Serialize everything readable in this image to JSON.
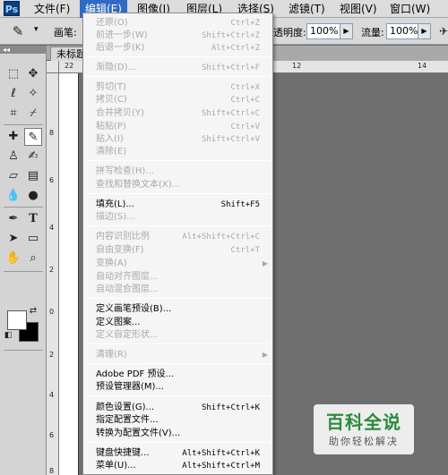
{
  "app": {
    "logo": "Ps"
  },
  "menubar": {
    "items": [
      {
        "label": "文件(F)"
      },
      {
        "label": "编辑(E)"
      },
      {
        "label": "图像(I)"
      },
      {
        "label": "图层(L)"
      },
      {
        "label": "选择(S)"
      },
      {
        "label": "滤镜(T)"
      },
      {
        "label": "视图(V)"
      },
      {
        "label": "窗口(W)"
      }
    ]
  },
  "options_bar": {
    "brush_label": "画笔:",
    "opacity_label": "透明度:",
    "opacity_value": "100%",
    "flow_label": "流量:",
    "flow_value": "100%"
  },
  "document": {
    "tab_title": "未标题",
    "ruler_h": [
      "22",
      "12",
      "14"
    ],
    "ruler_v": [
      "8",
      "6",
      "4",
      "2",
      "0",
      "2",
      "4",
      "6",
      "8"
    ]
  },
  "toolbox": {
    "collapse": "◂◂"
  },
  "edit_menu": {
    "items": [
      {
        "label": "还原(O)",
        "shortcut": "Ctrl+Z",
        "enabled": false
      },
      {
        "label": "前进一步(W)",
        "shortcut": "Shift+Ctrl+Z",
        "enabled": false
      },
      {
        "label": "后退一步(K)",
        "shortcut": "Alt+Ctrl+Z",
        "enabled": false
      },
      {
        "label": "渐隐(D)...",
        "shortcut": "Shift+Ctrl+F",
        "enabled": false
      },
      {
        "label": "剪切(T)",
        "shortcut": "Ctrl+X",
        "enabled": false
      },
      {
        "label": "拷贝(C)",
        "shortcut": "Ctrl+C",
        "enabled": false
      },
      {
        "label": "合并拷贝(Y)",
        "shortcut": "Shift+Ctrl+C",
        "enabled": false
      },
      {
        "label": "粘贴(P)",
        "shortcut": "Ctrl+V",
        "enabled": false
      },
      {
        "label": "贴入(I)",
        "shortcut": "Shift+Ctrl+V",
        "enabled": false
      },
      {
        "label": "清除(E)",
        "shortcut": "",
        "enabled": false
      },
      {
        "label": "拼写检查(H)...",
        "shortcut": "",
        "enabled": false
      },
      {
        "label": "查找和替换文本(X)...",
        "shortcut": "",
        "enabled": false
      },
      {
        "label": "填充(L)...",
        "shortcut": "Shift+F5",
        "enabled": true
      },
      {
        "label": "描边(S)...",
        "shortcut": "",
        "enabled": false
      },
      {
        "label": "内容识别比例",
        "shortcut": "Alt+Shift+Ctrl+C",
        "enabled": false
      },
      {
        "label": "自由变换(F)",
        "shortcut": "Ctrl+T",
        "enabled": false
      },
      {
        "label": "变换(A)",
        "shortcut": "",
        "enabled": false,
        "submenu": true
      },
      {
        "label": "自动对齐图层...",
        "shortcut": "",
        "enabled": false
      },
      {
        "label": "自动混合图层...",
        "shortcut": "",
        "enabled": false
      },
      {
        "label": "定义画笔预设(B)...",
        "shortcut": "",
        "enabled": true
      },
      {
        "label": "定义图案...",
        "shortcut": "",
        "enabled": true
      },
      {
        "label": "定义自定形状...",
        "shortcut": "",
        "enabled": false
      },
      {
        "label": "清理(R)",
        "shortcut": "",
        "enabled": false,
        "submenu": true
      },
      {
        "label": "Adobe PDF 预设...",
        "shortcut": "",
        "enabled": true
      },
      {
        "label": "预设管理器(M)...",
        "shortcut": "",
        "enabled": true
      },
      {
        "label": "颜色设置(G)...",
        "shortcut": "Shift+Ctrl+K",
        "enabled": true
      },
      {
        "label": "指定配置文件...",
        "shortcut": "",
        "enabled": true
      },
      {
        "label": "转换为配置文件(V)...",
        "shortcut": "",
        "enabled": true
      },
      {
        "label": "键盘快捷键...",
        "shortcut": "Alt+Shift+Ctrl+K",
        "enabled": true
      },
      {
        "label": "菜单(U)...",
        "shortcut": "Alt+Shift+Ctrl+M",
        "enabled": true
      }
    ]
  },
  "watermark": {
    "title": "百科全说",
    "subtitle": "助你轻松解决"
  },
  "colors": {
    "menu_active": "#316ac5",
    "disabled_text": "#a8a8a8",
    "watermark_green": "#2b8a3e"
  }
}
